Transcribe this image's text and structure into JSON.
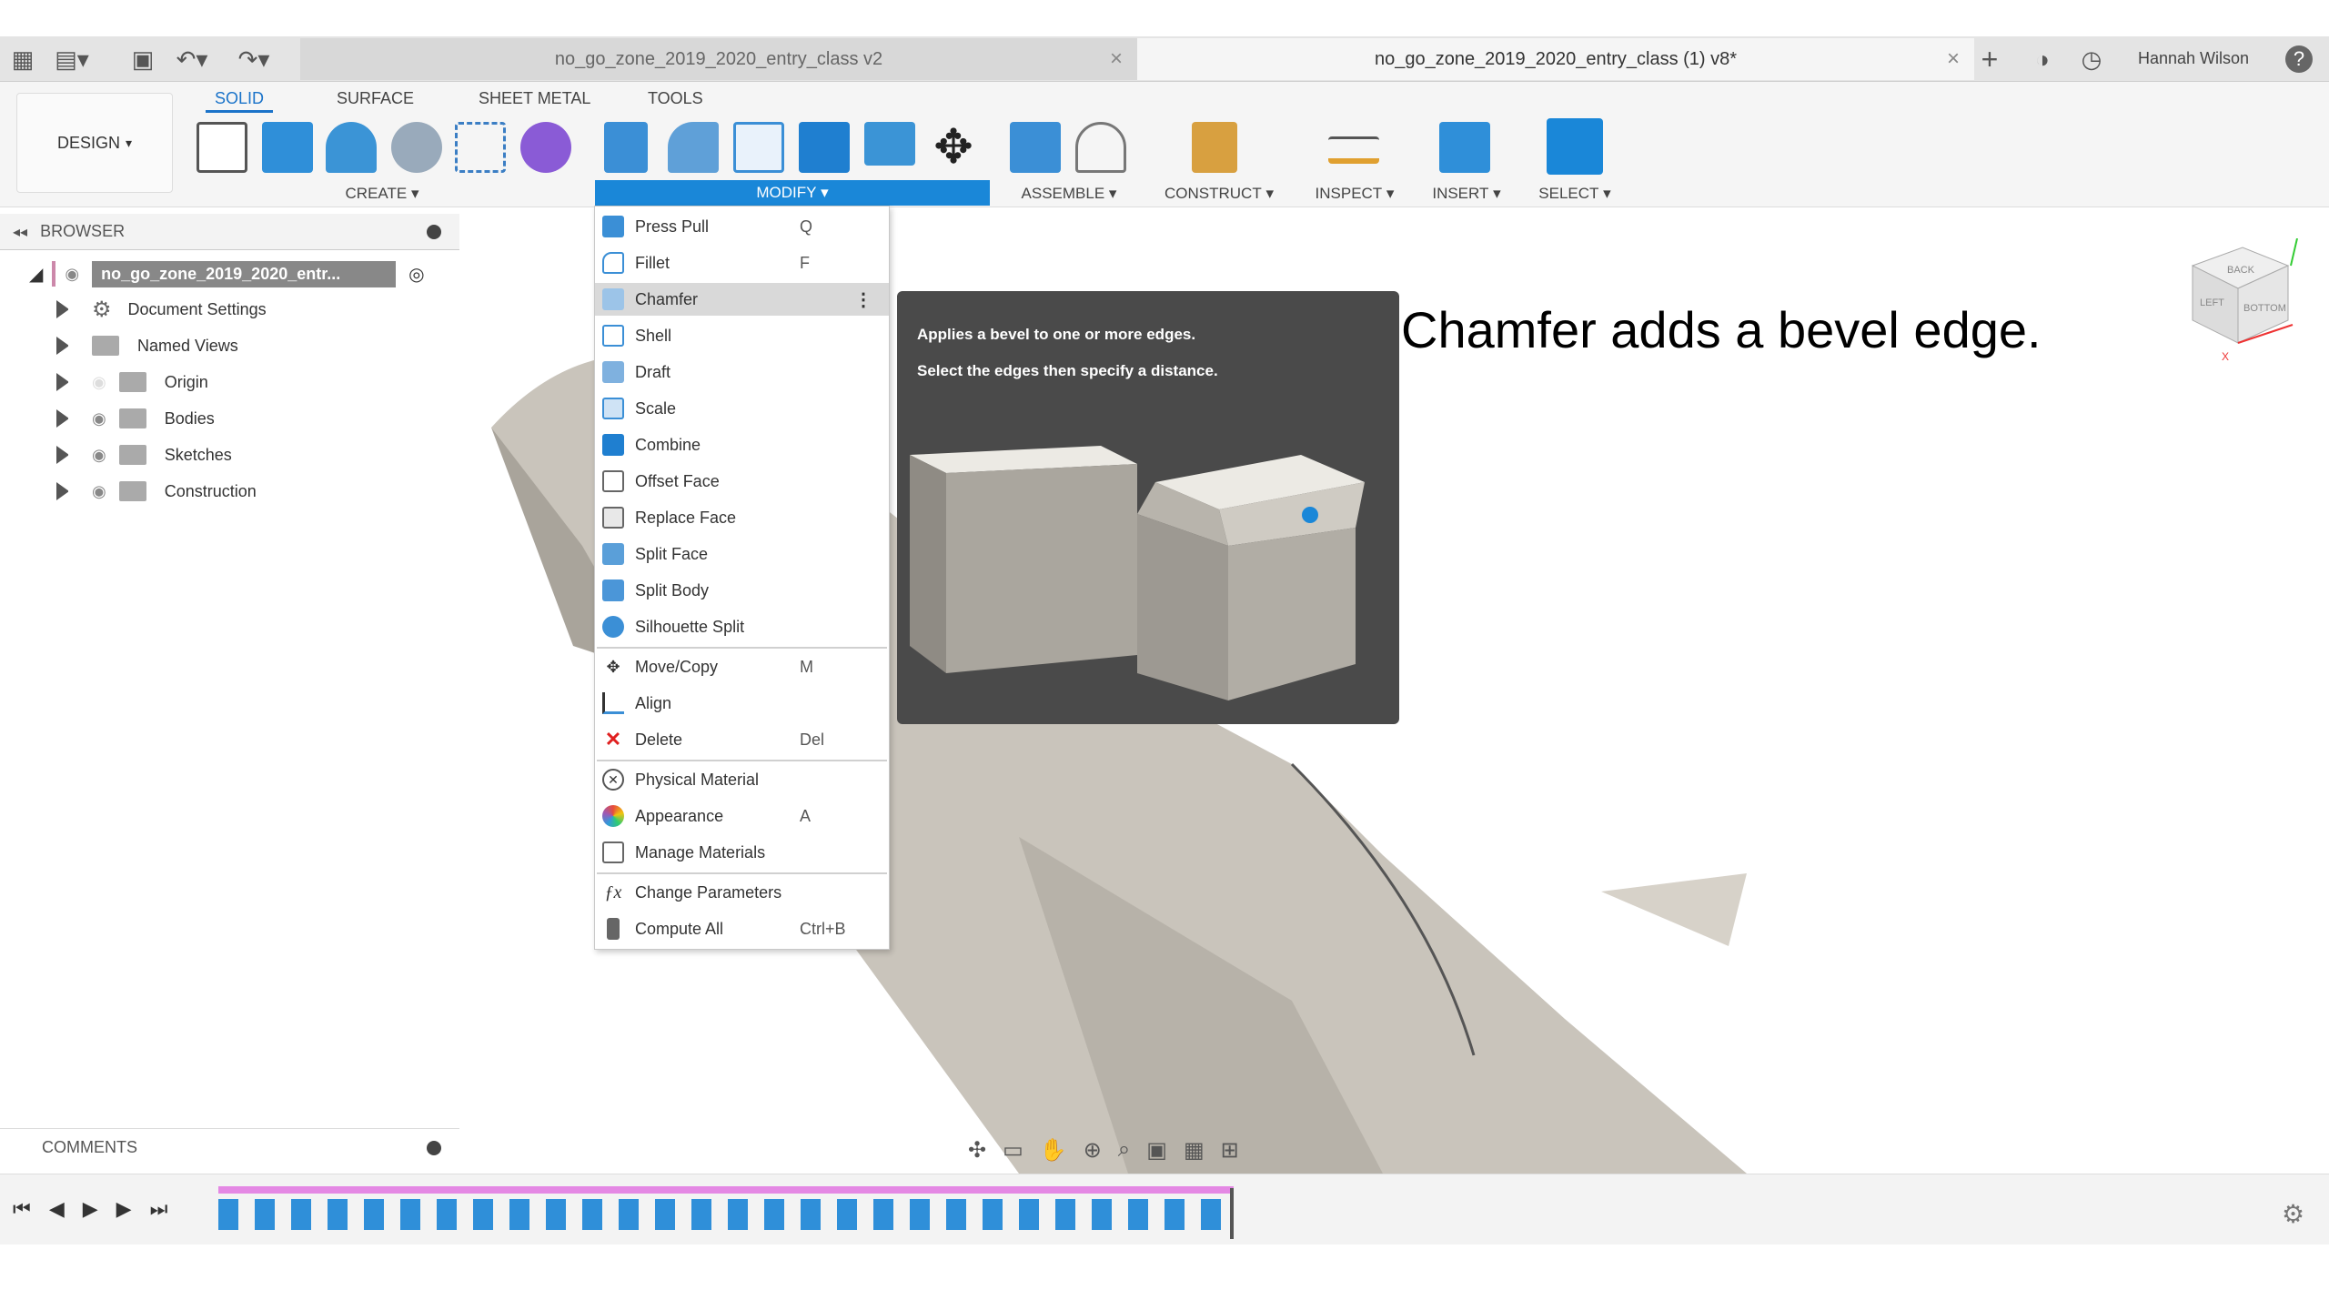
{
  "app": {
    "user_name": "Hannah Wilson",
    "tabs": [
      {
        "title": "no_go_zone_2019_2020_entry_class v2"
      },
      {
        "title": "no_go_zone_2019_2020_entry_class (1) v8*"
      }
    ],
    "close_glyph": "×",
    "add_glyph": "+",
    "help_glyph": "?"
  },
  "toolbar": {
    "workspace": "DESIGN",
    "tabs": [
      "SOLID",
      "SURFACE",
      "SHEET METAL",
      "TOOLS"
    ],
    "groups": {
      "create": "CREATE",
      "modify": "MODIFY",
      "assemble": "ASSEMBLE",
      "construct": "CONSTRUCT",
      "inspect": "INSPECT",
      "insert": "INSERT",
      "select": "SELECT"
    }
  },
  "browser": {
    "title": "BROWSER",
    "root": "no_go_zone_2019_2020_entr...",
    "items": [
      "Document Settings",
      "Named Views",
      "Origin",
      "Bodies",
      "Sketches",
      "Construction"
    ]
  },
  "modify_menu": {
    "items": [
      {
        "label": "Press Pull",
        "shortcut": "Q"
      },
      {
        "label": "Fillet",
        "shortcut": "F"
      },
      {
        "label": "Chamfer",
        "shortcut": ""
      },
      {
        "label": "Shell",
        "shortcut": ""
      },
      {
        "label": "Draft",
        "shortcut": ""
      },
      {
        "label": "Scale",
        "shortcut": ""
      },
      {
        "label": "Combine",
        "shortcut": ""
      },
      {
        "label": "Offset Face",
        "shortcut": ""
      },
      {
        "label": "Replace Face",
        "shortcut": ""
      },
      {
        "label": "Split Face",
        "shortcut": ""
      },
      {
        "label": "Split Body",
        "shortcut": ""
      },
      {
        "label": "Silhouette Split",
        "shortcut": ""
      },
      {
        "label": "Move/Copy",
        "shortcut": "M"
      },
      {
        "label": "Align",
        "shortcut": ""
      },
      {
        "label": "Delete",
        "shortcut": "Del"
      },
      {
        "label": "Physical Material",
        "shortcut": ""
      },
      {
        "label": "Appearance",
        "shortcut": "A"
      },
      {
        "label": "Manage Materials",
        "shortcut": ""
      },
      {
        "label": "Change Parameters",
        "shortcut": ""
      },
      {
        "label": "Compute All",
        "shortcut": "Ctrl+B"
      }
    ]
  },
  "tooltip": {
    "line1": "Applies a bevel to one or more edges.",
    "line2": "Select the edges then specify a distance."
  },
  "caption": "Chamfer adds a bevel edge.",
  "comments": {
    "title": "COMMENTS"
  },
  "viewcube": {
    "back": "BACK",
    "left": "LEFT",
    "bottom": "BOTTOM",
    "axis_x": "X"
  }
}
